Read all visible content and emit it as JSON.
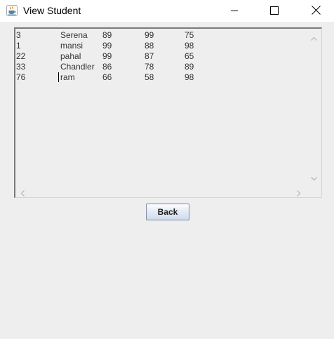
{
  "window": {
    "title": "View Student",
    "icon": "java-cup-icon",
    "controls": [
      "minimize-icon",
      "maximize-icon",
      "close-icon"
    ]
  },
  "records": [
    {
      "id": "3",
      "name": "Serena",
      "m1": "89",
      "m2": "99",
      "m3": "75"
    },
    {
      "id": "1",
      "name": "mansi",
      "m1": "99",
      "m2": "88",
      "m3": "98"
    },
    {
      "id": "22",
      "name": "pahal",
      "m1": "99",
      "m2": "87",
      "m3": "65"
    },
    {
      "id": "33",
      "name": "Chandler",
      "m1": "86",
      "m2": "78",
      "m3": "89"
    },
    {
      "id": "76",
      "name": "ram",
      "m1": "66",
      "m2": "58",
      "m3": "98"
    }
  ],
  "back_button": {
    "label": "Back"
  },
  "colors": {
    "background": "#eeeeee",
    "titlebar": "#ffffff",
    "text": "#333333"
  }
}
